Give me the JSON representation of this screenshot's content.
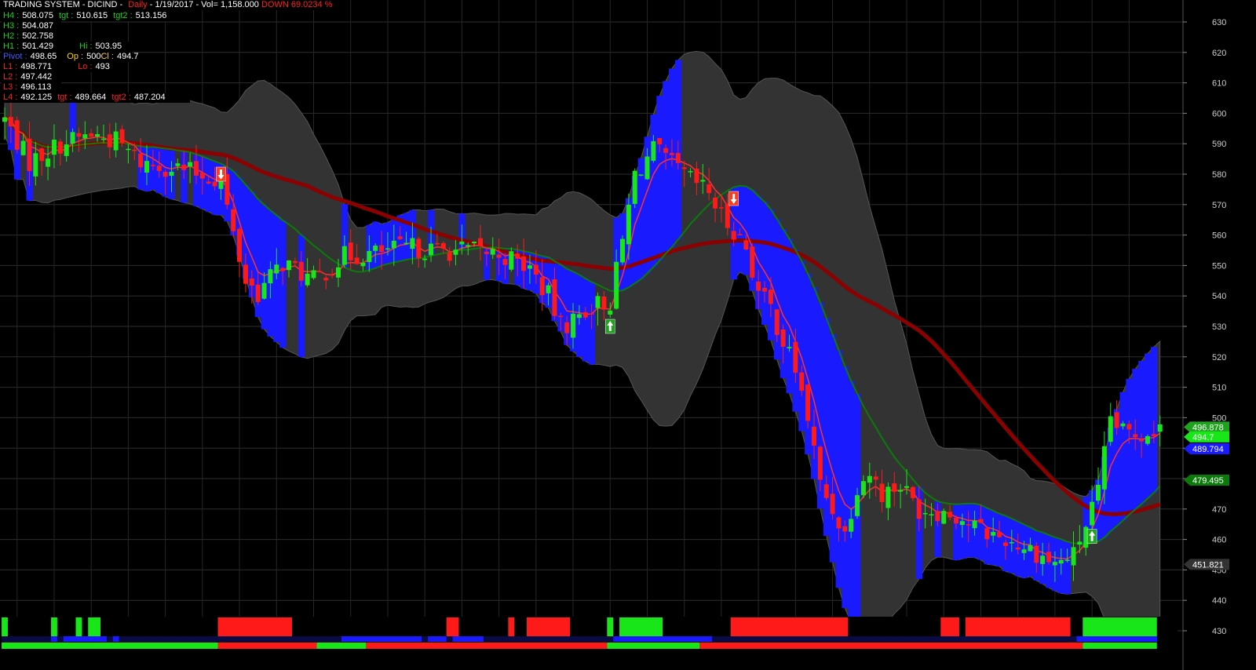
{
  "header": {
    "title": "TRADING SYSTEM - DICIND - ",
    "period": "Daily",
    "date_vol": " - 1/19/2017 - Vol= 1,158.000 ",
    "trend": "DOWN 69.0234 %"
  },
  "levels": {
    "h4": {
      "label": "H4 :",
      "value": "508.075",
      "tgt_label": "tgt :",
      "tgt": "510.615",
      "tgt2_label": "tgt2 :",
      "tgt2": "513.156"
    },
    "h3": {
      "label": "H3 :",
      "value": "504.087"
    },
    "h2": {
      "label": "H2 :",
      "value": "502.758"
    },
    "h1": {
      "label": "H1 :",
      "value": "501.429",
      "hi_label": "Hi :",
      "hi": "503.95"
    },
    "pivot": {
      "label": "Pivot :",
      "value": "498.65",
      "op_label": "Op :",
      "op": "500",
      "cl_label": "Cl :",
      "cl": "494.7"
    },
    "l1": {
      "label": "L1 :",
      "value": "498.771",
      "lo_label": "Lo :",
      "lo": "493"
    },
    "l2": {
      "label": "L2 :",
      "value": "497.442"
    },
    "l3": {
      "label": "L3 :",
      "value": "496.113"
    },
    "l4": {
      "label": "L4 :",
      "value": "492.125",
      "tgt_label": "tgt :",
      "tgt": "489.664",
      "tgt2_label": "tgt2 :",
      "tgt2": "487.204"
    }
  },
  "colors": {
    "background": "#000000",
    "grid": "#2e2e2e",
    "bull": "#19e619",
    "bear": "#ff1a1a",
    "band_blue": "#1a1aff",
    "band_gray": "#333333",
    "sma_long": "#8b0000",
    "sma_mid": "#0b7a0b",
    "ema_fast": "#ff3030",
    "ema_fast_up": "#2ec42e",
    "buy_arrow": "#1fa31f",
    "sell_arrow": "#ff3a1a"
  },
  "chart_data": {
    "type": "candlestick",
    "ylim": [
      426,
      634
    ],
    "y_ticks": [
      630,
      620,
      610,
      600,
      590,
      580,
      570,
      560,
      550,
      540,
      530,
      520,
      510,
      500,
      490,
      480,
      470,
      460,
      450,
      440,
      430
    ],
    "price_labels": [
      {
        "text": "496.878",
        "value": 496.9,
        "color": "#1fa31f"
      },
      {
        "text": "494.7",
        "value": 493.7,
        "color": "#19e619"
      },
      {
        "text": "489.794",
        "value": 489.8,
        "color": "#1a1aff"
      },
      {
        "text": "479.495",
        "value": 479.5,
        "color": "#0b7a0b"
      },
      {
        "text": "451.821",
        "value": 451.8,
        "color": "#333333"
      }
    ],
    "signals": [
      {
        "type": "sell",
        "bar": 35,
        "value": 580
      },
      {
        "type": "buy",
        "bar": 98,
        "value": 530
      },
      {
        "type": "sell",
        "bar": 118,
        "value": 572
      },
      {
        "type": "buy",
        "bar": 176,
        "value": 461
      }
    ],
    "trend_bars": [
      {
        "row": 1,
        "from": 0,
        "to": 1,
        "color": "green"
      },
      {
        "row": 1,
        "from": 8,
        "to": 9,
        "color": "green"
      },
      {
        "row": 1,
        "from": 12,
        "to": 13,
        "color": "green"
      },
      {
        "row": 1,
        "from": 14,
        "to": 16,
        "color": "green"
      },
      {
        "row": 1,
        "from": 35,
        "to": 47,
        "color": "red"
      },
      {
        "row": 1,
        "from": 72,
        "to": 74,
        "color": "red"
      },
      {
        "row": 1,
        "from": 82,
        "to": 83,
        "color": "red"
      },
      {
        "row": 1,
        "from": 85,
        "to": 92,
        "color": "red"
      },
      {
        "row": 1,
        "from": 98,
        "to": 99,
        "color": "green"
      },
      {
        "row": 1,
        "from": 100,
        "to": 107,
        "color": "green"
      },
      {
        "row": 1,
        "from": 118,
        "to": 137,
        "color": "red"
      },
      {
        "row": 1,
        "from": 152,
        "to": 155,
        "color": "red"
      },
      {
        "row": 1,
        "from": 156,
        "to": 173,
        "color": "red"
      },
      {
        "row": 1,
        "from": 175,
        "to": 187,
        "color": "green"
      },
      {
        "row": 2,
        "from": 0,
        "to": 187,
        "color": "mixed"
      },
      {
        "row": 3,
        "from": 0,
        "to": 35,
        "color": "green"
      },
      {
        "row": 3,
        "from": 35,
        "to": 51,
        "color": "red"
      },
      {
        "row": 3,
        "from": 51,
        "to": 59,
        "color": "green"
      },
      {
        "row": 3,
        "from": 59,
        "to": 98,
        "color": "red"
      },
      {
        "row": 3,
        "from": 98,
        "to": 113,
        "color": "green"
      },
      {
        "row": 3,
        "from": 113,
        "to": 175,
        "color": "red"
      },
      {
        "row": 3,
        "from": 175,
        "to": 187,
        "color": "green"
      }
    ]
  }
}
